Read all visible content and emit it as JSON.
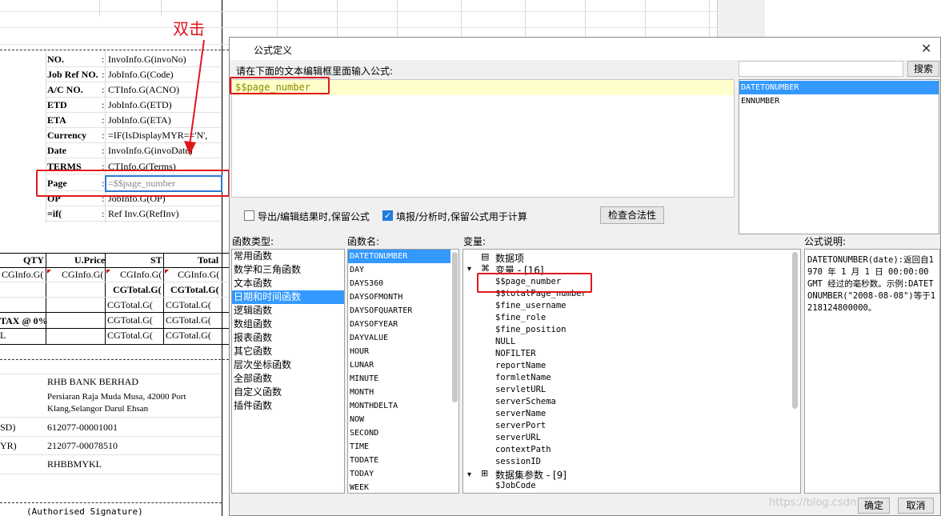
{
  "annotation": {
    "text": "双击",
    "color": "#e0161d"
  },
  "sheet": {
    "fields": [
      {
        "label": "NO.",
        "value": "InvoInfo.G(invoNo)"
      },
      {
        "label": "Job Ref NO.",
        "value": "JobInfo.G(Code)"
      },
      {
        "label": "A/C NO.",
        "value": "CTInfo.G(ACNO)"
      },
      {
        "label": "ETD",
        "value": "JobInfo.G(ETD)"
      },
      {
        "label": "ETA",
        "value": "JobInfo.G(ETA)"
      },
      {
        "label": "Currency",
        "value": "=IF(IsDisplayMYR=='N',"
      },
      {
        "label": "Date",
        "value": "InvoInfo.G(invoDate)"
      },
      {
        "label": "TERMS",
        "value": "CTInfo.G(Terms)"
      },
      {
        "label": "Page",
        "value": "=$$page_number"
      },
      {
        "label": "OP",
        "value": "JobInfo.G(OP)"
      },
      {
        "label": "=if(",
        "value": "Ref Inv.G(RefInv)"
      }
    ],
    "colon": ":",
    "table_headers": [
      "QTY",
      "U.Price",
      "ST",
      "Total"
    ],
    "table_row1": [
      "CGInfo.G(",
      "CGInfo.G(",
      "CGInfo.G(",
      "CGInfo.G("
    ],
    "cgtotal": "CGTotal.G(",
    "tax_label": "TAX @ 0%",
    "bank_name": "RHB BANK BERHAD",
    "bank_address1": "Persiaran Raja Muda Musa, 42000 Port",
    "bank_address2": "Klang,Selangor Darul Ehsan",
    "acct1_label": "SD)",
    "acct1": "612077-00001001",
    "acct2_label": "YR)",
    "acct2": "212077-00078510",
    "swift": "RHBBMYKL",
    "signature": "(Authorised Signature)",
    "left_letter": "L"
  },
  "dialog": {
    "title": "公式定义",
    "instruction": "请在下面的文本编辑框里面输入公式:",
    "formula": "$$page_number",
    "search_placeholder": "",
    "search_button": "搜索",
    "search_results": [
      "DATETONUMBER",
      "ENNUMBER"
    ],
    "option_export": "导出/编辑结果时,保留公式",
    "option_fill": "填报/分析时,保留公式用于计算",
    "option_export_checked": false,
    "option_fill_checked": true,
    "check_button": "检查合法性",
    "func_type_label": "函数类型:",
    "func_name_label": "函数名:",
    "var_label": "变量:",
    "desc_label": "公式说明:",
    "func_types": [
      "常用函数",
      "数学和三角函数",
      "文本函数",
      "日期和时间函数",
      "逻辑函数",
      "数组函数",
      "报表函数",
      "其它函数",
      "层次坐标函数",
      "全部函数",
      "自定义函数",
      "插件函数"
    ],
    "func_type_selected": 3,
    "func_names": [
      "DATETONUMBER",
      "DAY",
      "DAYS360",
      "DAYSOFMONTH",
      "DAYSOFQUARTER",
      "DAYSOFYEAR",
      "DAYVALUE",
      "HOUR",
      "LUNAR",
      "MINUTE",
      "MONTH",
      "MONTHDELTA",
      "NOW",
      "SECOND",
      "TIME",
      "TODATE",
      "TODAY",
      "WEEK"
    ],
    "func_name_selected": 0,
    "var_root1": "数据项",
    "var_root2": "变量 - [16]",
    "variables": [
      "$$page_number",
      "$$totalPage_number",
      "$fine_username",
      "$fine_role",
      "$fine_position",
      "NULL",
      "NOFILTER",
      "reportName",
      "formletName",
      "servletURL",
      "serverSchema",
      "serverName",
      "serverPort",
      "serverURL",
      "contextPath",
      "sessionID"
    ],
    "var_root3": "数据集参数 - [9]",
    "var_sub3": "$JobCode",
    "description": "DATETONUMBER(date):返回自1970 年 1 月 1 日 00:00:00 GMT 经过的毫秒数。示例:DATETONUMBER(\"2008-08-08\")等于1218124800000。",
    "ok_button": "确定",
    "cancel_button": "取消",
    "watermark": "https://blog.csdn.net/..."
  },
  "colors": {
    "highlight_red": "#e0161d",
    "selection_blue": "#3399ff",
    "formula_bg": "#ffffcc",
    "formula_text": "#8a8a00"
  }
}
